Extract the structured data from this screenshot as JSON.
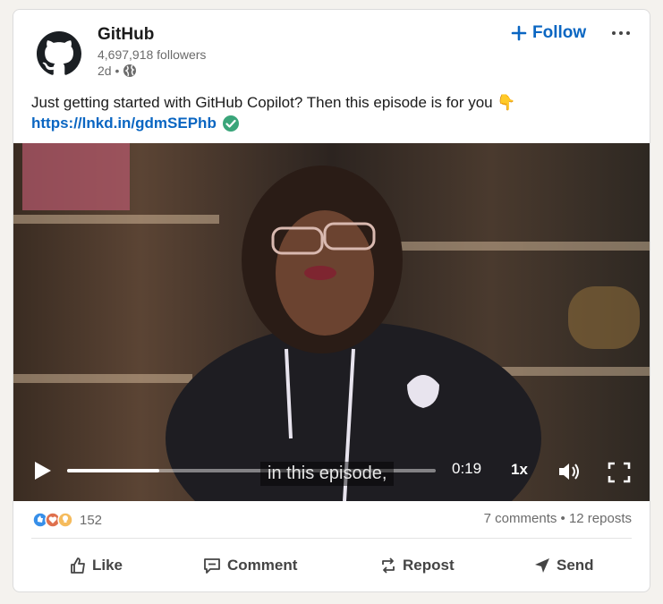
{
  "post": {
    "author": "GitHub",
    "followers": "4,697,918 followers",
    "time": "2d •",
    "follow_label": "Follow",
    "text": "Just getting started with GitHub Copilot? Then this episode is for you 👇",
    "link": "https://lnkd.in/gdmSEPhb"
  },
  "video": {
    "caption": "in this episode,",
    "current_time": "0:19",
    "speed": "1x",
    "progress": 0.25
  },
  "engagement": {
    "reaction_count": "152",
    "stats": "7 comments • 12 reposts"
  },
  "actions": {
    "like": "Like",
    "comment": "Comment",
    "repost": "Repost",
    "send": "Send"
  },
  "colors": {
    "accent": "#0a66c2",
    "verified": "#3aa57a"
  }
}
